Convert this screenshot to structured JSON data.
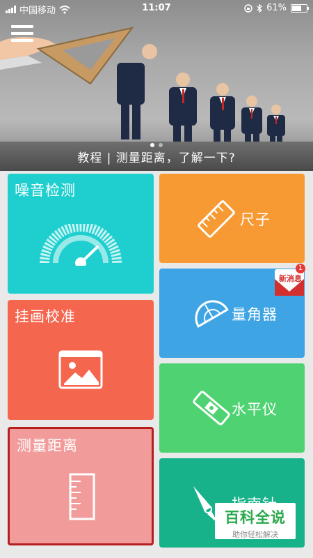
{
  "status_bar": {
    "carrier": "中国移动",
    "time": "11:07",
    "battery": "61%"
  },
  "banner": {
    "caption": "教程 | 测量距离，了解一下?",
    "page_count": 2
  },
  "tiles": {
    "noise": {
      "label": "噪音检测",
      "icon": "gauge-icon",
      "color": "#1fcfcf"
    },
    "hang": {
      "label": "挂画校准",
      "icon": "picture-frame-icon",
      "color": "#f5664f"
    },
    "distance": {
      "label": "测量距离",
      "icon": "ruler-vertical-icon",
      "color": "#f29b9b",
      "selected": true
    },
    "ruler": {
      "label": "尺子",
      "icon": "ruler-icon",
      "color": "#f79a33"
    },
    "angle": {
      "label": "量角器",
      "icon": "protractor-icon",
      "color": "#3ea4e3"
    },
    "level": {
      "label": "水平仪",
      "icon": "spirit-level-icon",
      "color": "#4fd272"
    },
    "compass": {
      "label": "指南针",
      "icon": "compass-icon",
      "color": "#17b28a"
    }
  },
  "new_message_badge": {
    "text": "新消息",
    "count": "1"
  },
  "watermark": {
    "title": "百科全说",
    "subtitle": "助你轻松解决"
  }
}
